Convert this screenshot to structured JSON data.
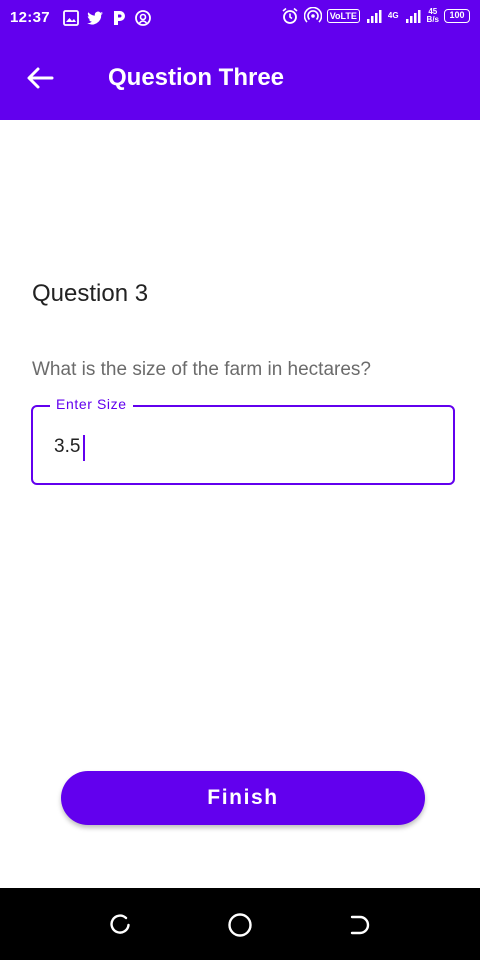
{
  "status_bar": {
    "time": "12:37",
    "left_icons": [
      "gallery-icon",
      "twitter-icon",
      "paytm-icon",
      "signal-app-icon"
    ],
    "volte": "VoLTE",
    "network_type": "4G",
    "speed_value": "45",
    "speed_unit": "B/s",
    "battery": "100"
  },
  "app_bar": {
    "title": "Question Three",
    "back_icon": "arrow-back-icon",
    "background": "#6200EE"
  },
  "question": {
    "heading": "Question 3",
    "text": "What is the size of the farm in hectares?"
  },
  "input": {
    "label": "Enter Size",
    "value": "3.5",
    "accent": "#6200EE"
  },
  "finish_button": {
    "label": "Finish"
  },
  "nav_bar": {
    "buttons": [
      "recents-icon",
      "home-icon",
      "back-icon"
    ]
  }
}
